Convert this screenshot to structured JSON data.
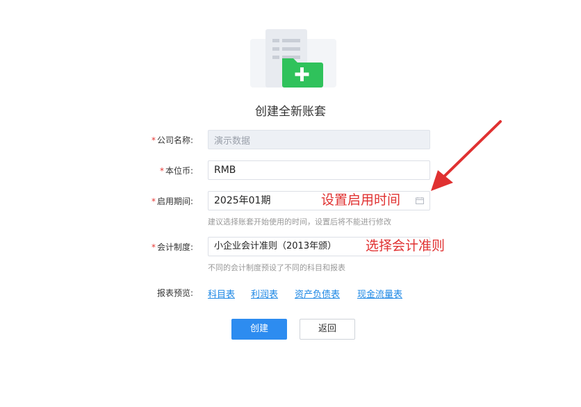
{
  "header": {
    "title": "创建全新账套"
  },
  "form": {
    "required_mark": "*",
    "company_name": {
      "label": "公司名称:",
      "value": "演示数据",
      "disabled": true
    },
    "currency": {
      "label": "本位币:",
      "value": "RMB"
    },
    "start_period": {
      "label": "启用期间:",
      "value": "2025年01期",
      "hint": "建议选择账套开始使用的时间，设置后将不能进行修改",
      "icon": "calendar-icon"
    },
    "accounting_system": {
      "label": "会计制度:",
      "value": "小企业会计准则（2013年颁）",
      "hint": "不同的会计制度预设了不同的科目和报表"
    },
    "report_preview": {
      "label": "报表预览:",
      "links": [
        "科目表",
        "利润表",
        "资产负债表",
        "现金流量表"
      ]
    }
  },
  "buttons": {
    "create": "创建",
    "back": "返回"
  },
  "annotations": {
    "set_start_time": "设置启用时间",
    "choose_standard": "选择会计准则"
  },
  "colors": {
    "primary": "#2d8cf0",
    "link": "#1e88e5",
    "required": "#e53935",
    "annotation": "#e03131",
    "folder_green": "#2fc25b"
  }
}
